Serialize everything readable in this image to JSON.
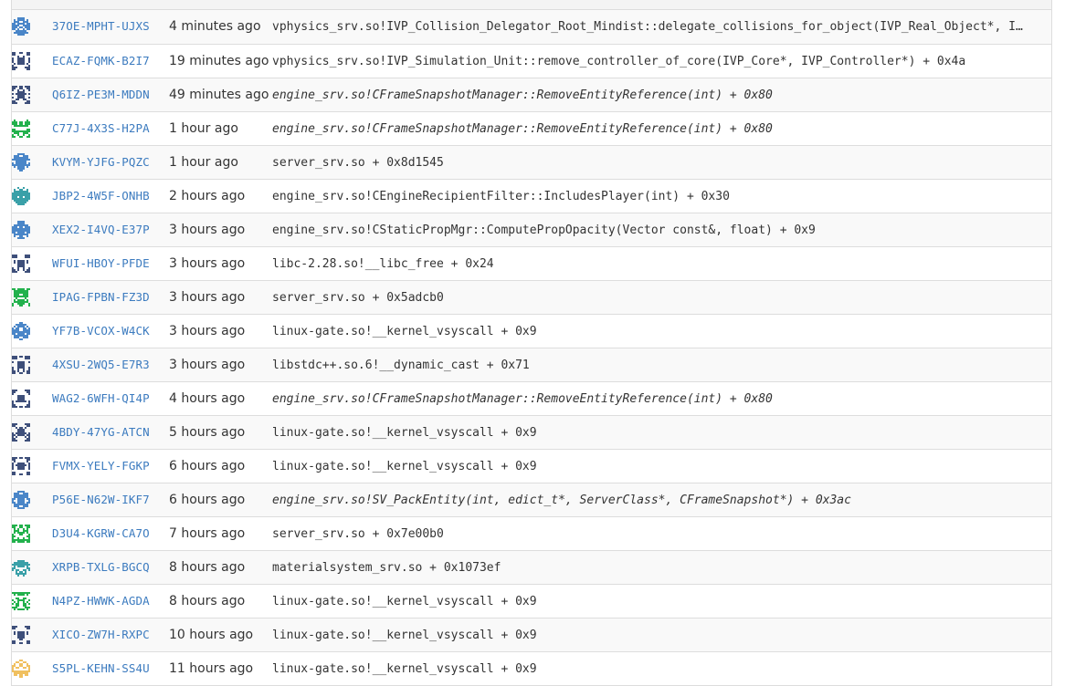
{
  "colors": {
    "link": "#3c7bbf",
    "text": "#333333",
    "border": "#dddddd",
    "row_alt": "#f9f9f9"
  },
  "crashes": [
    {
      "id": "37OE-MPHT-UJXS",
      "time": "4 minutes ago",
      "signature": "vphysics_srv.so!IVP_Collision_Delegator_Root_Mindist::delegate_collisions_for_object(IVP_Real_Object*, I…",
      "italic": false,
      "icon_color": "#4a86c8",
      "icon_kind": "blob"
    },
    {
      "id": "ECAZ-FQMK-B2I7",
      "time": "19 minutes ago",
      "signature": "vphysics_srv.so!IVP_Simulation_Unit::remove_controller_of_core(IVP_Core*, IVP_Controller*) + 0x4a",
      "italic": false,
      "icon_color": "#3e4f7a",
      "icon_kind": "cross"
    },
    {
      "id": "Q6IZ-PE3M-MDDN",
      "time": "49 minutes ago",
      "signature": "engine_srv.so!CFrameSnapshotManager::RemoveEntityReference(int) + 0x80",
      "italic": true,
      "icon_color": "#3e4f7a",
      "icon_kind": "cross"
    },
    {
      "id": "C77J-4X3S-H2PA",
      "time": "1 hour ago",
      "signature": "engine_srv.so!CFrameSnapshotManager::RemoveEntityReference(int) + 0x80",
      "italic": true,
      "icon_color": "#22b14c",
      "icon_kind": "noise"
    },
    {
      "id": "KVYM-YJFG-PQZC",
      "time": "1 hour ago",
      "signature": "server_srv.so + 0x8d1545",
      "italic": false,
      "icon_color": "#4a86c8",
      "icon_kind": "blob"
    },
    {
      "id": "JBP2-4W5F-ONHB",
      "time": "2 hours ago",
      "signature": "engine_srv.so!CEngineRecipientFilter::IncludesPlayer(int) + 0x30",
      "italic": false,
      "icon_color": "#3aa0a8",
      "icon_kind": "blob"
    },
    {
      "id": "XEX2-I4VQ-E37P",
      "time": "3 hours ago",
      "signature": "engine_srv.so!CStaticPropMgr::ComputePropOpacity(Vector const&, float) + 0x9",
      "italic": false,
      "icon_color": "#4a86c8",
      "icon_kind": "blob"
    },
    {
      "id": "WFUI-HBOY-PFDE",
      "time": "3 hours ago",
      "signature": "libc-2.28.so!__libc_free + 0x24",
      "italic": false,
      "icon_color": "#3e4f7a",
      "icon_kind": "cross"
    },
    {
      "id": "IPAG-FPBN-FZ3D",
      "time": "3 hours ago",
      "signature": "server_srv.so + 0x5adcb0",
      "italic": false,
      "icon_color": "#22b14c",
      "icon_kind": "noise"
    },
    {
      "id": "YF7B-VCOX-W4CK",
      "time": "3 hours ago",
      "signature": "linux-gate.so!__kernel_vsyscall + 0x9",
      "italic": false,
      "icon_color": "#4a86c8",
      "icon_kind": "blob"
    },
    {
      "id": "4XSU-2WQ5-E7R3",
      "time": "3 hours ago",
      "signature": "libstdc++.so.6!__dynamic_cast + 0x71",
      "italic": false,
      "icon_color": "#3e4f7a",
      "icon_kind": "cross"
    },
    {
      "id": "WAG2-6WFH-QI4P",
      "time": "4 hours ago",
      "signature": "engine_srv.so!CFrameSnapshotManager::RemoveEntityReference(int) + 0x80",
      "italic": true,
      "icon_color": "#3e4f7a",
      "icon_kind": "cross"
    },
    {
      "id": "4BDY-47YG-ATCN",
      "time": "5 hours ago",
      "signature": "linux-gate.so!__kernel_vsyscall + 0x9",
      "italic": false,
      "icon_color": "#3e4f7a",
      "icon_kind": "cross"
    },
    {
      "id": "FVMX-YELY-FGKP",
      "time": "6 hours ago",
      "signature": "linux-gate.so!__kernel_vsyscall + 0x9",
      "italic": false,
      "icon_color": "#3e4f7a",
      "icon_kind": "cross"
    },
    {
      "id": "P56E-N62W-IKF7",
      "time": "6 hours ago",
      "signature": "engine_srv.so!SV_PackEntity(int, edict_t*, ServerClass*, CFrameSnapshot*) + 0x3ac",
      "italic": true,
      "icon_color": "#4a86c8",
      "icon_kind": "blob"
    },
    {
      "id": "D3U4-KGRW-CA7O",
      "time": "7 hours ago",
      "signature": "server_srv.so + 0x7e00b0",
      "italic": false,
      "icon_color": "#22b14c",
      "icon_kind": "noise"
    },
    {
      "id": "XRPB-TXLG-BGCQ",
      "time": "8 hours ago",
      "signature": "materialsystem_srv.so + 0x1073ef",
      "italic": false,
      "icon_color": "#3aa0a8",
      "icon_kind": "blob"
    },
    {
      "id": "N4PZ-HWWK-AGDA",
      "time": "8 hours ago",
      "signature": "linux-gate.so!__kernel_vsyscall + 0x9",
      "italic": false,
      "icon_color": "#22b14c",
      "icon_kind": "noise"
    },
    {
      "id": "XICO-ZW7H-RXPC",
      "time": "10 hours ago",
      "signature": "linux-gate.so!__kernel_vsyscall + 0x9",
      "italic": false,
      "icon_color": "#3e4f7a",
      "icon_kind": "cross"
    },
    {
      "id": "S5PL-KEHN-SS4U",
      "time": "11 hours ago",
      "signature": "linux-gate.so!__kernel_vsyscall + 0x9",
      "italic": false,
      "icon_color": "#f0c060",
      "icon_kind": "blob"
    }
  ]
}
